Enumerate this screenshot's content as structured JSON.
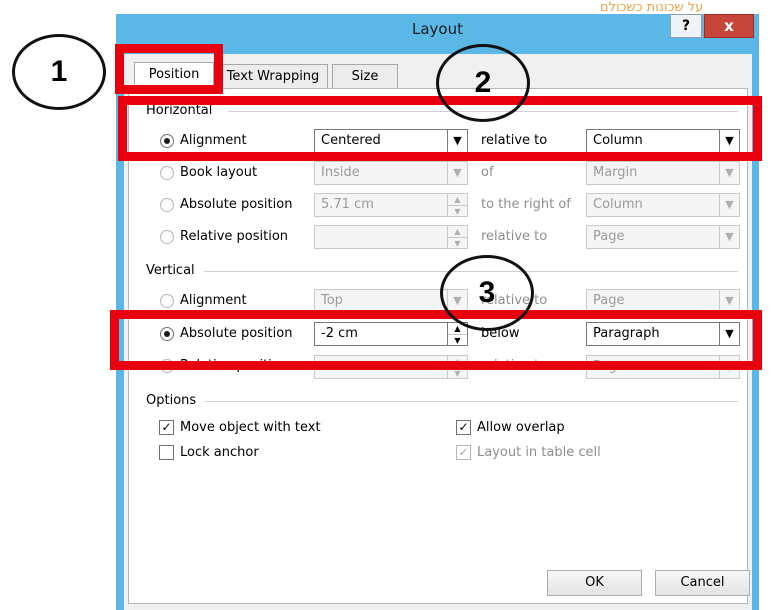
{
  "window": {
    "title": "Layout",
    "overflow_text": "על שכונות כשכולם",
    "help_label": "?",
    "close_label": "x"
  },
  "tabs": [
    {
      "label": "Position",
      "active": true
    },
    {
      "label": "Text Wrapping",
      "active": false
    },
    {
      "label": "Size",
      "active": false
    }
  ],
  "horizontal": {
    "title": "Horizontal",
    "rows": [
      {
        "label": "Alignment",
        "selected": true,
        "value": "Centered",
        "relation": "relative to",
        "target": "Column",
        "enabled": true
      },
      {
        "label": "Book layout",
        "selected": false,
        "value": "Inside",
        "relation": "of",
        "target": "Margin",
        "enabled": false
      },
      {
        "label": "Absolute position",
        "selected": false,
        "value": "5.71 cm",
        "relation": "to the right of",
        "target": "Column",
        "enabled": false
      },
      {
        "label": "Relative position",
        "selected": false,
        "value": "",
        "relation": "relative to",
        "target": "Page",
        "enabled": false
      }
    ]
  },
  "vertical": {
    "title": "Vertical",
    "rows": [
      {
        "label": "Alignment",
        "selected": false,
        "value": "Top",
        "relation": "relative to",
        "target": "Page",
        "enabled": false
      },
      {
        "label": "Absolute position",
        "selected": true,
        "value": "-2 cm",
        "relation": "below",
        "target": "Paragraph",
        "enabled": true
      },
      {
        "label": "Relative position",
        "selected": false,
        "value": "",
        "relation": "relative to",
        "target": "Page",
        "enabled": false
      }
    ]
  },
  "options": {
    "title": "Options",
    "move_with_text": {
      "label": "Move object with text",
      "checked": true
    },
    "lock_anchor": {
      "label": "Lock anchor",
      "checked": false
    },
    "allow_overlap": {
      "label": "Allow overlap",
      "checked": true
    },
    "layout_in_table": {
      "label": "Layout in table cell",
      "checked": true,
      "enabled": false
    }
  },
  "buttons": {
    "ok": "OK",
    "cancel": "Cancel"
  },
  "annotations": {
    "marker_1": "1",
    "marker_2": "2",
    "marker_3": "3",
    "highlight_color": "#e8000e"
  },
  "colors": {
    "titlebar": "#5bb8e6",
    "close_button": "#c7463b"
  }
}
